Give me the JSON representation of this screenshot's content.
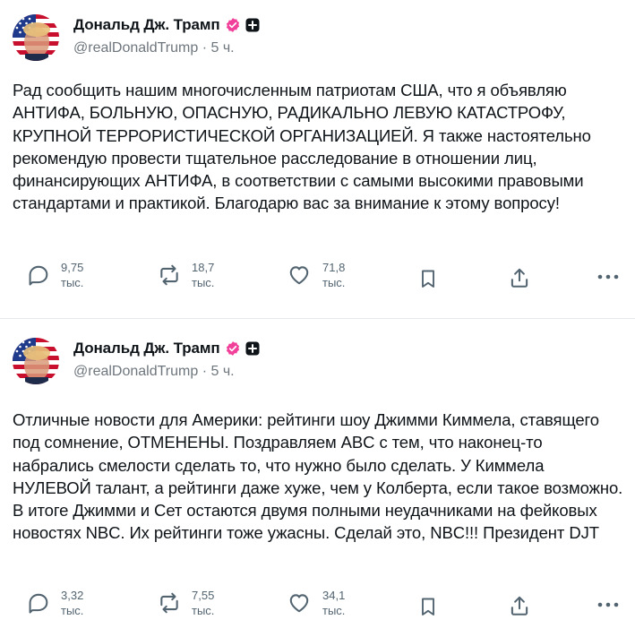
{
  "colors": {
    "text": "#0f1419",
    "muted": "#536471",
    "badge": "#f0409a",
    "divider": "#e6e9ec"
  },
  "posts": [
    {
      "author_name": "Дональд Дж. Трамп",
      "handle": "@realDonaldTrump",
      "separator": "·",
      "time": "5 ч.",
      "text": "Рад сообщить нашим многочисленным патриотам США, что я объявляю АНТИФА, БОЛЬНУЮ, ОПАСНУЮ, РАДИКАЛЬНО ЛЕВУЮ КАТАСТРОФУ, КРУПНОЙ ТЕРРОРИСТИЧЕСКОЙ ОРГАНИЗАЦИЕЙ. Я также настоятельно рекомендую провести тщательное расследование в отношении лиц, финансирующих АНТИФА, в соответствии с самыми высокими правовыми стандартами и практикой. Благодарю вас за внимание к этому вопросу!",
      "replies": {
        "value": "9,75",
        "unit": "тыс."
      },
      "reposts": {
        "value": "18,7",
        "unit": "тыс."
      },
      "likes": {
        "value": "71,8",
        "unit": "тыс."
      },
      "icons": [
        "reply-icon",
        "repost-icon",
        "like-icon",
        "bookmark-icon",
        "share-icon",
        "more-icon"
      ]
    },
    {
      "author_name": "Дональд Дж. Трамп",
      "handle": "@realDonaldTrump",
      "separator": "·",
      "time": "5 ч.",
      "text": "Отличные новости для Америки: рейтинги шоу Джимми Киммела, ставящего под сомнение, ОТМЕНЕНЫ. Поздравляем ABC с тем, что наконец-то набрались смелости сделать то, что нужно было сделать. У Киммела НУЛЕВОЙ талант, а рейтинги даже хуже, чем у Колберта, если такое возможно. В итоге Джимми и Сет остаются двумя полными неудачниками на фейковых новостях NBC. Их рейтинги тоже ужасны. Сделай это, NBC!!! Президент DJT",
      "replies": {
        "value": "3,32",
        "unit": "тыс."
      },
      "reposts": {
        "value": "7,55",
        "unit": "тыс."
      },
      "likes": {
        "value": "34,1",
        "unit": "тыс."
      },
      "icons": [
        "reply-icon",
        "repost-icon",
        "like-icon",
        "bookmark-icon",
        "share-icon",
        "more-icon"
      ]
    }
  ]
}
